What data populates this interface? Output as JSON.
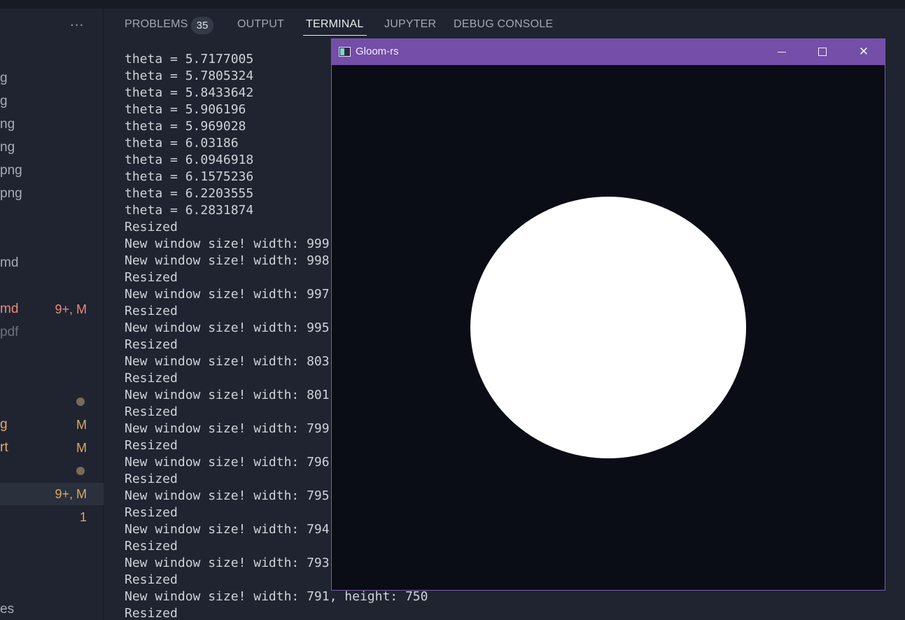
{
  "sidebar": {
    "more_label": "···",
    "items": [
      {
        "label": "g",
        "badge": "",
        "style": "normal"
      },
      {
        "label": "g",
        "badge": "",
        "style": "normal"
      },
      {
        "label": "ng",
        "badge": "",
        "style": "normal"
      },
      {
        "label": "ng",
        "badge": "",
        "style": "normal"
      },
      {
        "label": "png",
        "badge": "",
        "style": "normal"
      },
      {
        "label": "png",
        "badge": "",
        "style": "normal"
      },
      {
        "label": "md",
        "badge": "",
        "style": "normal"
      },
      {
        "label": "md",
        "badge": "9+, M",
        "style": "error"
      },
      {
        "label": "pdf",
        "badge": "",
        "style": "dim"
      },
      {
        "label": "",
        "badge": "",
        "style": "dot"
      },
      {
        "label": "g",
        "badge": "M",
        "style": "modified"
      },
      {
        "label": "rt",
        "badge": "M",
        "style": "modified"
      },
      {
        "label": "",
        "badge": "",
        "style": "dot"
      },
      {
        "label": "",
        "badge": "9+, M",
        "style": "selected"
      },
      {
        "label": "",
        "badge": "1",
        "style": "count"
      },
      {
        "label": "es",
        "badge": "",
        "style": "normal"
      }
    ]
  },
  "panel": {
    "tabs": {
      "problems": "PROBLEMS",
      "problems_count": "35",
      "output": "OUTPUT",
      "terminal": "TERMINAL",
      "jupyter": "JUPYTER",
      "debug_console": "DEBUG CONSOLE"
    },
    "active_tab": "TERMINAL"
  },
  "terminal": {
    "lines": [
      "theta = 5.7177005",
      "theta = 5.7805324",
      "theta = 5.8433642",
      "theta = 5.906196",
      "theta = 5.969028",
      "theta = 6.03186",
      "theta = 6.0946918",
      "theta = 6.1575236",
      "theta = 6.2203555",
      "theta = 6.2831874",
      "Resized",
      "New window size! width: 999",
      "New window size! width: 998",
      "Resized",
      "New window size! width: 997",
      "Resized",
      "New window size! width: 995",
      "Resized",
      "New window size! width: 803",
      "Resized",
      "New window size! width: 801",
      "Resized",
      "New window size! width: 799",
      "Resized",
      "New window size! width: 796",
      "Resized",
      "New window size! width: 795",
      "Resized",
      "New window size! width: 794",
      "Resized",
      "New window size! width: 793",
      "Resized",
      "New window size! width: 791, height: 750",
      "Resized"
    ]
  },
  "window": {
    "title": "Gloom-rs",
    "buttons": {
      "minimize": "minimize-icon",
      "maximize": "maximize-icon",
      "close": "close-icon"
    },
    "close_glyph": "✕",
    "canvas_background": "#0a0d15",
    "shape_color": "#ffffff",
    "titlebar_color": "#744ea9"
  }
}
